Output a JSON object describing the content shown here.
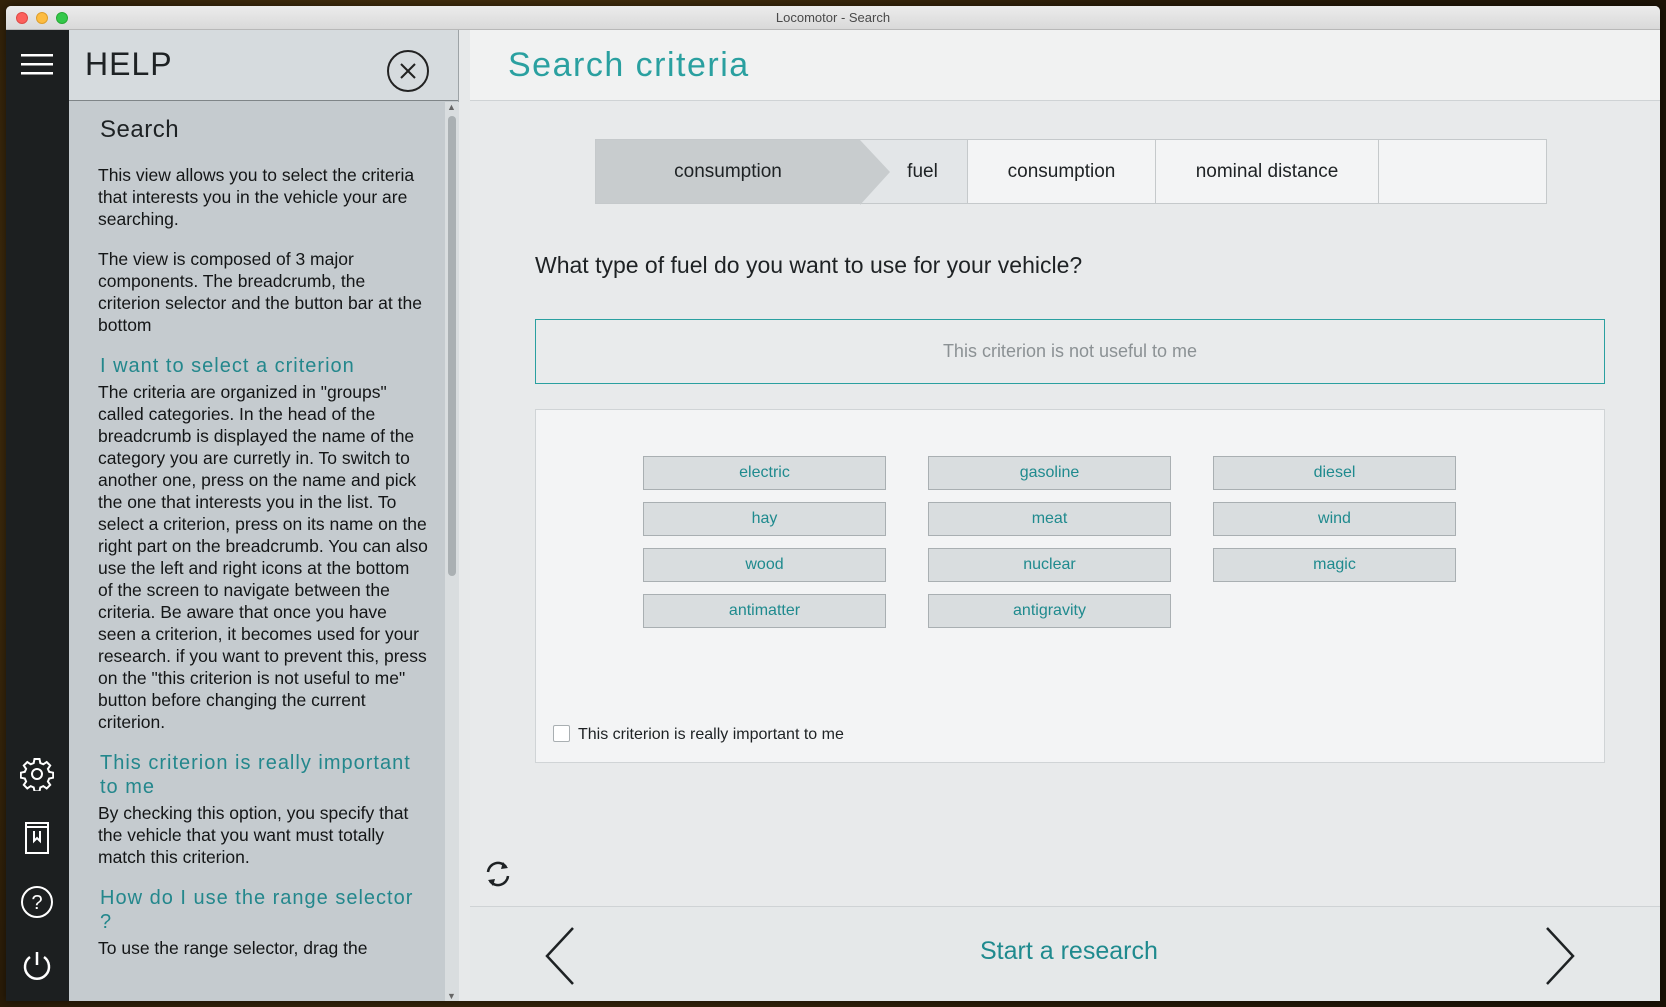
{
  "window": {
    "title": "Locomotor - Search"
  },
  "rail": {
    "icons": [
      "hamburger-menu-icon",
      "gear-icon",
      "bookmark-book-icon",
      "help-icon",
      "power-icon"
    ]
  },
  "help": {
    "title": "HELP",
    "section_title": "Search",
    "intro_1": "This view allows you to select the criteria that interests you in the vehicle your are searching.",
    "intro_2": "The view is composed of 3 major components. The breadcrumb, the criterion selector and the button bar at the bottom",
    "h_select": "I want to select a criterion",
    "p_select": "The criteria are organized in \"groups\" called categories. In the head of the breadcrumb is displayed the name of the category you are curretly in. To switch to another one, press on the name and pick the one that interests you in the list. To select a criterion, press on its name on the right part on the breadcrumb. You can also use the left and right icons at the bottom of the screen to navigate between the criteria. Be aware that once you have seen a criterion, it becomes used for your research. if you want to prevent this, press on the \"this criterion is not useful to me\" button before changing the current criterion.",
    "h_important": "This criterion is really important to me",
    "p_important": "By checking this option, you specify that the vehicle that you want must totally match this criterion.",
    "h_range": "How do I use the range selector ?",
    "p_range": "To use the range selector, drag the"
  },
  "main": {
    "title": "Search criteria",
    "breadcrumb": {
      "category": "consumption",
      "items": [
        "fuel",
        "consumption",
        "nominal distance"
      ]
    },
    "question": "What type of fuel do you want to use for your vehicle?",
    "not_useful": "This criterion is not useful to me",
    "options": [
      "electric",
      "gasoline",
      "diesel",
      "hay",
      "meat",
      "wind",
      "wood",
      "nuclear",
      "magic",
      "antimatter",
      "antigravity"
    ],
    "important_label": "This criterion is really important to me",
    "important_checked": false,
    "start_label": "Start a research"
  },
  "colors": {
    "accent": "#2aa0a0",
    "rail": "#1c1f20",
    "help_bg": "#c5cbcf"
  }
}
